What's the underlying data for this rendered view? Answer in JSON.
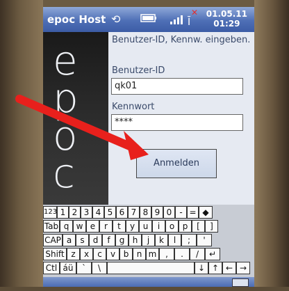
{
  "status_bar": {
    "app_title": "epoc Host",
    "date": "01.05.11",
    "time": "01:29",
    "icons": [
      "sync-icon",
      "battery-icon",
      "signal-icon",
      "no-connection-icon"
    ]
  },
  "logo": {
    "letters": [
      "e",
      "p",
      "o",
      "c"
    ]
  },
  "login": {
    "prompt": "Benutzer-ID, Kennw. eingeben.",
    "user_id_label": "Benutzer-ID",
    "user_id_value": "qk01",
    "password_label": "Kennwort",
    "password_value": "****",
    "login_button": "Anmelden"
  },
  "keyboard": {
    "rows": [
      [
        "123",
        "1",
        "2",
        "3",
        "4",
        "5",
        "6",
        "7",
        "8",
        "9",
        "0",
        "-",
        "=",
        "◆"
      ],
      [
        "Tab",
        "q",
        "w",
        "e",
        "r",
        "t",
        "y",
        "u",
        "i",
        "o",
        "p",
        "[",
        "]"
      ],
      [
        "CAP",
        "a",
        "s",
        "d",
        "f",
        "g",
        "h",
        "j",
        "k",
        "l",
        ";",
        "'"
      ],
      [
        "Shift",
        "z",
        "x",
        "c",
        "v",
        "b",
        "n",
        "m",
        ",",
        ".",
        "/",
        "↵"
      ],
      [
        "Ctl",
        "áü",
        "`",
        "\\",
        "",
        "↓",
        "↑",
        "←",
        "→"
      ]
    ]
  },
  "colors": {
    "status_bar": "#4e6fb6",
    "arrow": "#e8201c",
    "screen_bg": "#e6eaf2"
  }
}
